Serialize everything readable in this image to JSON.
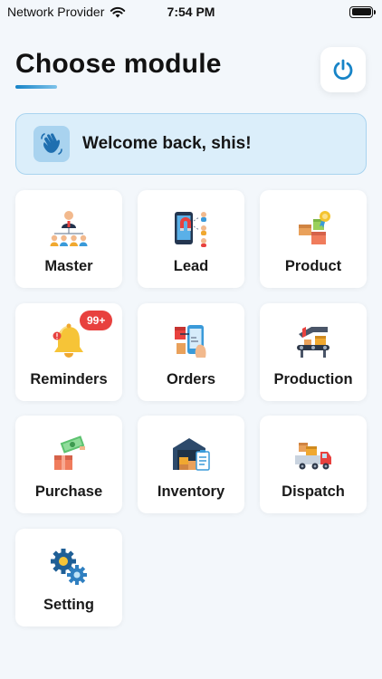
{
  "status_bar": {
    "carrier": "Network Provider",
    "time": "7:54 PM"
  },
  "header": {
    "title": "Choose module"
  },
  "welcome": {
    "text": "Welcome back, shis!"
  },
  "modules": [
    {
      "label": "Master",
      "icon": "team-hierarchy-icon"
    },
    {
      "label": "Lead",
      "icon": "lead-magnet-icon"
    },
    {
      "label": "Product",
      "icon": "product-boxes-icon"
    },
    {
      "label": "Reminders",
      "icon": "bell-icon",
      "badge": "99+"
    },
    {
      "label": "Orders",
      "icon": "order-phone-icon"
    },
    {
      "label": "Production",
      "icon": "conveyor-icon"
    },
    {
      "label": "Purchase",
      "icon": "cash-box-icon"
    },
    {
      "label": "Inventory",
      "icon": "warehouse-icon"
    },
    {
      "label": "Dispatch",
      "icon": "delivery-truck-icon"
    },
    {
      "label": "Setting",
      "icon": "gears-icon"
    }
  ],
  "colors": {
    "accent": "#1784c7",
    "badge": "#e8413e",
    "welcome_bg": "#dbeefa"
  }
}
